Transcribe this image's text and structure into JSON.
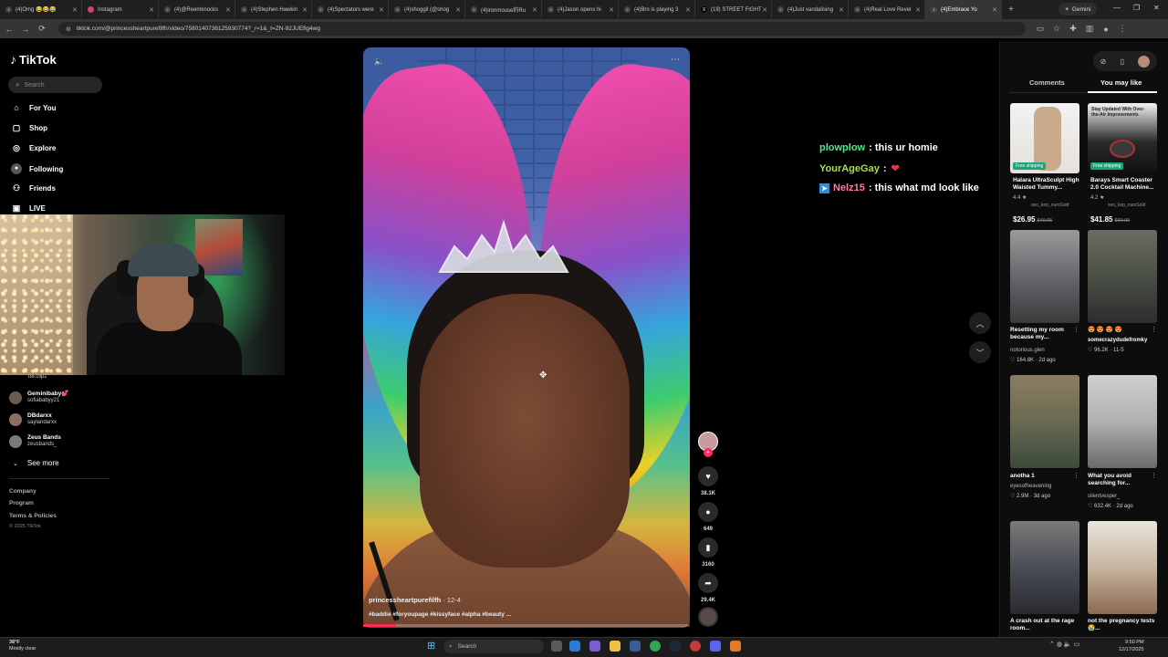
{
  "browser": {
    "tabs": [
      {
        "label": "(4)Omg 😂😂😂"
      },
      {
        "label": "Instagram"
      },
      {
        "label": "(4)@Reemknocks"
      },
      {
        "label": "(4)Stephen Hawkin"
      },
      {
        "label": "(4)Spectators were"
      },
      {
        "label": "(4)shoggil (@shog"
      },
      {
        "label": "(4)ironmouse的Ru"
      },
      {
        "label": "(4)Jason opens hi"
      },
      {
        "label": "(4)Bro is playing 3"
      },
      {
        "label": "(19) STREET FIGHT"
      },
      {
        "label": "(4)Just vandalising"
      },
      {
        "label": "(4)Real Love Revel"
      },
      {
        "label": "(4)Embrace Yo"
      }
    ],
    "gemini_label": "Gemini",
    "url": "tiktok.com/@princessheartpurefilfh/video/7580140736125930774?_r=1&_t=ZN-92JUEfig4wg"
  },
  "sidebar": {
    "logo": "TikTok",
    "search_placeholder": "Search",
    "items": [
      {
        "label": "For You",
        "icon": "home-icon"
      },
      {
        "label": "Shop",
        "icon": "shop-icon"
      },
      {
        "label": "Explore",
        "icon": "compass-icon"
      },
      {
        "label": "Following",
        "icon": "following-icon"
      },
      {
        "label": "Friends",
        "icon": "friends-icon"
      },
      {
        "label": "LIVE",
        "icon": "live-icon"
      }
    ],
    "following_accounts": [
      {
        "name": "",
        "handle": "b8.clipz"
      },
      {
        "name": "Geminibaby💕",
        "handle": "sofiababyy21"
      },
      {
        "name": "DBdarxx",
        "handle": "saylandarxx"
      },
      {
        "name": "Zeus Bands",
        "handle": "zeusbands_"
      }
    ],
    "see_more": "See more",
    "footer": {
      "links": [
        "Company",
        "Program",
        "Terms & Policies"
      ],
      "copyright": "© 2025 TikTok"
    }
  },
  "video": {
    "author": "princessheartpurefilfh",
    "date": "· 12-4",
    "hashtags": "#baddie #foryoupage #kissyface #alpha #beauty ...",
    "progress": 0.1,
    "actions": [
      {
        "name": "like",
        "count": "38.1K"
      },
      {
        "name": "comment",
        "count": "649"
      },
      {
        "name": "bookmark",
        "count": "3160"
      },
      {
        "name": "share",
        "count": "29.4K"
      }
    ]
  },
  "chat": [
    {
      "user": "plowplow",
      "message": ": this ur homie"
    },
    {
      "user": "YourAgeGay",
      "message": ":"
    },
    {
      "user": "Nelz15",
      "message": ": this what md look like"
    }
  ],
  "right_panel": {
    "tabs": {
      "comments": "Comments",
      "you_may_like": "You may like"
    },
    "cards": [
      {
        "title": "Halara UltraSculpt High Waisted Tummy...",
        "rating": "4.4 ★",
        "seller": "seo_kep_numSold",
        "price": "$26.95",
        "old_price": "$49.95",
        "tag": "Free shipping"
      },
      {
        "title": "Barays Smart Coaster 2.0 Cocktail Machine...",
        "rating": "4.2 ★",
        "seller": "seo_kep_numSold",
        "price": "$41.85",
        "old_price": "$69.99",
        "tag": "Free shipping",
        "ad_text": "Stay Updated With Over-the-Air Improvements"
      },
      {
        "title": "Resetting my room because my...",
        "author": "notorious.glen",
        "meta": "♡ 164.8K · 2d ago"
      },
      {
        "title": "😍 😍 😍 😍",
        "author": "somecrazydudefromky",
        "meta": "♡ 96.2K · 11-5"
      },
      {
        "title": "anotha 1",
        "author": "eyesofheavening",
        "meta": "♡ 2.9M · 3d ago"
      },
      {
        "title": "What you avoid searching for...",
        "author": "silentvesper_",
        "meta": "♡ 632.4K · 2d ago"
      },
      {
        "title": "A crash out at the rage room...",
        "author": "",
        "meta": ""
      },
      {
        "title": "not the pregnancy tests 😭...",
        "author": "",
        "meta": ""
      }
    ]
  },
  "taskbar": {
    "weather_temp": "38°F",
    "weather_desc": "Mostly clear",
    "search_placeholder": "Search",
    "time": "9:50 PM",
    "date": "12/17/2025"
  }
}
